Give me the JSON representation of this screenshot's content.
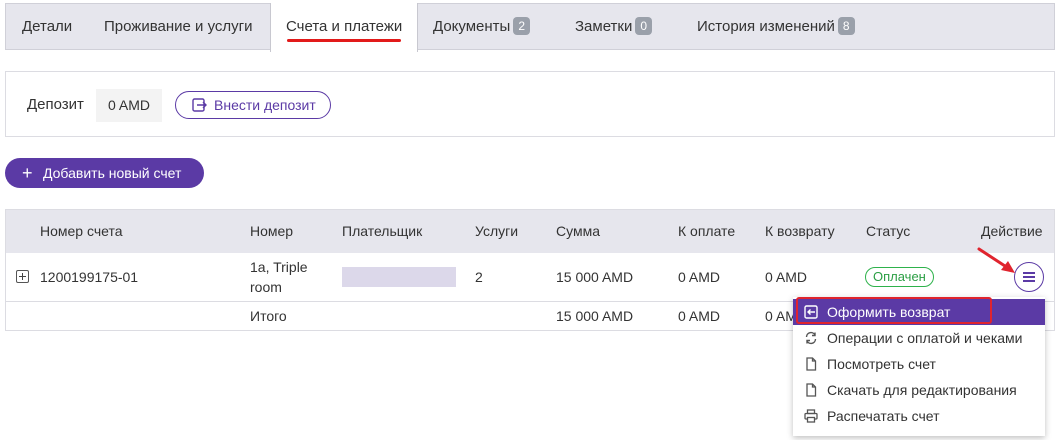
{
  "tabs": [
    {
      "label": "Детали",
      "badge": null
    },
    {
      "label": "Проживание и услуги",
      "badge": null
    },
    {
      "label": "Счета и платежи",
      "badge": null,
      "active": true
    },
    {
      "label": "Документы",
      "badge": "2"
    },
    {
      "label": "Заметки",
      "badge": "0"
    },
    {
      "label": "История изменений",
      "badge": "8"
    }
  ],
  "deposit": {
    "label": "Депозит",
    "value": "0 AMD",
    "button_label": "Внести депозит"
  },
  "add_invoice_label": "Добавить новый счет",
  "table": {
    "headers": [
      "Номер счета",
      "Номер",
      "Плательщик",
      "Услуги",
      "Сумма",
      "К оплате",
      "К возврату",
      "Статус",
      "Действие"
    ],
    "row": {
      "invoice_no": "1200199175-01",
      "room_line1": "1a, Triple",
      "room_line2": "room",
      "payer": "",
      "services": "2",
      "amount": "15 000 AMD",
      "to_pay": "0 AMD",
      "refund": "0 AMD",
      "status": "Оплачен"
    },
    "total": {
      "label": "Итого",
      "amount": "15 000 AMD",
      "to_pay": "0 AMD",
      "refund": "0 AM"
    }
  },
  "menu": {
    "items": [
      {
        "label": "Оформить возврат",
        "icon": "refund-icon",
        "highlighted": true
      },
      {
        "label": "Операции с оплатой и чеками",
        "icon": "sync-icon"
      },
      {
        "label": "Посмотреть счет",
        "icon": "document-icon"
      },
      {
        "label": "Скачать для редактирования",
        "icon": "document-icon"
      },
      {
        "label": "Распечатать счет",
        "icon": "printer-icon"
      }
    ]
  },
  "colors": {
    "accent": "#5b3aa5",
    "annotation": "#e0242e",
    "status_ok": "#2eb24b"
  }
}
